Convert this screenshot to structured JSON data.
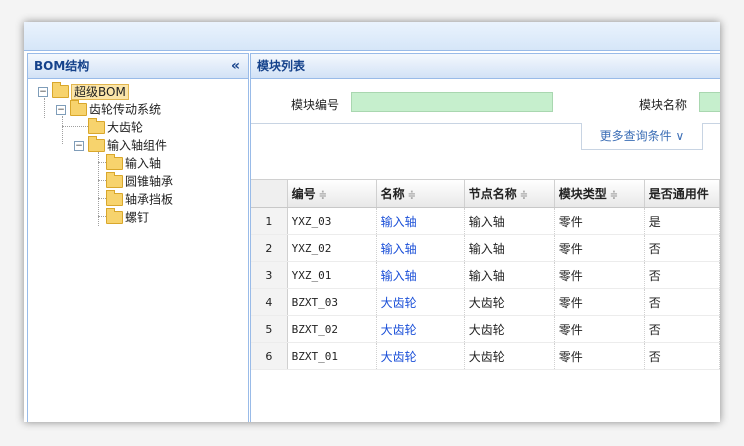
{
  "left_panel": {
    "title": "BOM结构",
    "collapse_glyph": "«",
    "tree": [
      {
        "label": "超级BOM",
        "toggle": "−",
        "selected": true
      },
      {
        "label": "齿轮传动系统",
        "toggle": "−"
      },
      {
        "label": "大齿轮"
      },
      {
        "label": "输入轴组件",
        "toggle": "−"
      },
      {
        "label": "输入轴"
      },
      {
        "label": "圆锥轴承"
      },
      {
        "label": "轴承挡板"
      },
      {
        "label": "螺钉"
      }
    ]
  },
  "right_panel": {
    "title": "模块列表",
    "search": {
      "field1_label": "模块编号",
      "field1_value": "",
      "field2_label": "模块名称",
      "field2_value": "",
      "more_button": "更多查询条件",
      "more_icon": "chevron-down-icon"
    },
    "grid": {
      "sort_icon": "≑",
      "columns": [
        "编号",
        "名称",
        "节点名称",
        "模块类型",
        "是否通用件"
      ],
      "rows": [
        {
          "n": "1",
          "code": "YXZ_03",
          "name": "输入轴",
          "node": "输入轴",
          "type": "零件",
          "common": "是"
        },
        {
          "n": "2",
          "code": "YXZ_02",
          "name": "输入轴",
          "node": "输入轴",
          "type": "零件",
          "common": "否"
        },
        {
          "n": "3",
          "code": "YXZ_01",
          "name": "输入轴",
          "node": "输入轴",
          "type": "零件",
          "common": "否"
        },
        {
          "n": "4",
          "code": "BZXT_03",
          "name": "大齿轮",
          "node": "大齿轮",
          "type": "零件",
          "common": "否"
        },
        {
          "n": "5",
          "code": "BZXT_02",
          "name": "大齿轮",
          "node": "大齿轮",
          "type": "零件",
          "common": "否"
        },
        {
          "n": "6",
          "code": "BZXT_01",
          "name": "大齿轮",
          "node": "大齿轮",
          "type": "零件",
          "common": "否"
        }
      ]
    }
  },
  "colors": {
    "header_text": "#15428b",
    "panel_border": "#99bbe8",
    "input_fill": "#c6efcd",
    "link": "#1a4fd8"
  }
}
